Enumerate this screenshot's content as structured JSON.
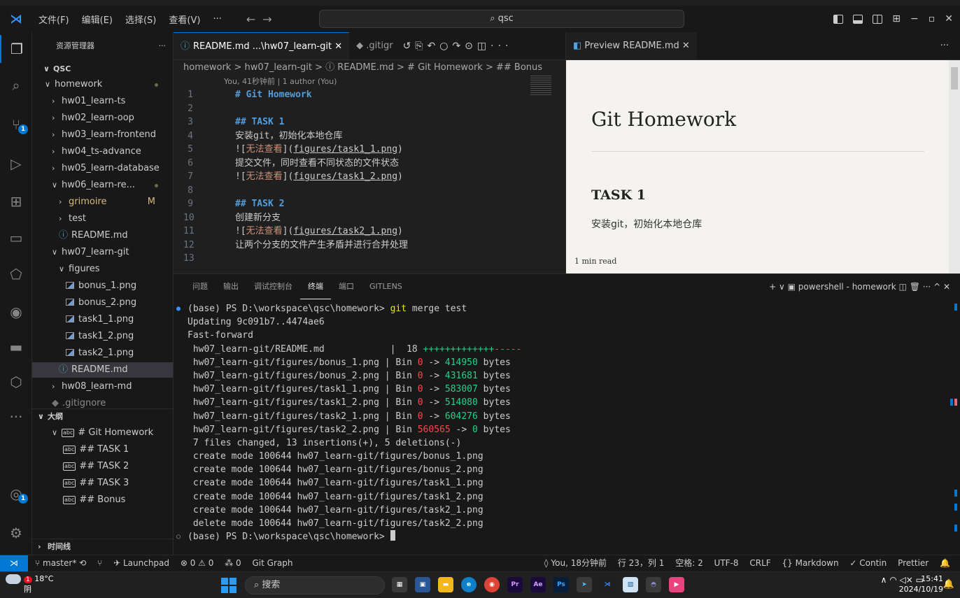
{
  "titlebar": {
    "menus": [
      "文件(F)",
      "编辑(E)",
      "选择(S)",
      "查看(V)",
      "···"
    ],
    "search": "qsc"
  },
  "sidebar": {
    "title": "资源管理器",
    "root": "QSC",
    "tree": [
      {
        "label": "homework",
        "depth": 1,
        "kind": "folder-open",
        "color": "#cccccc"
      },
      {
        "label": "hw01_learn-ts",
        "depth": 2,
        "kind": "folder"
      },
      {
        "label": "hw02_learn-oop",
        "depth": 2,
        "kind": "folder"
      },
      {
        "label": "hw03_learn-frontend",
        "depth": 2,
        "kind": "folder"
      },
      {
        "label": "hw04_ts-advance",
        "depth": 2,
        "kind": "folder"
      },
      {
        "label": "hw05_learn-database",
        "depth": 2,
        "kind": "folder"
      },
      {
        "label": "hw06_learn-re...",
        "depth": 2,
        "kind": "folder-open"
      },
      {
        "label": "grimoire",
        "depth": 3,
        "kind": "folder",
        "status": "M"
      },
      {
        "label": "test",
        "depth": 3,
        "kind": "folder"
      },
      {
        "label": "README.md",
        "depth": 3,
        "kind": "info"
      },
      {
        "label": "hw07_learn-git",
        "depth": 2,
        "kind": "folder-open"
      },
      {
        "label": "figures",
        "depth": 3,
        "kind": "folder-open"
      },
      {
        "label": "bonus_1.png",
        "depth": 4,
        "kind": "image"
      },
      {
        "label": "bonus_2.png",
        "depth": 4,
        "kind": "image"
      },
      {
        "label": "task1_1.png",
        "depth": 4,
        "kind": "image"
      },
      {
        "label": "task1_2.png",
        "depth": 4,
        "kind": "image"
      },
      {
        "label": "task2_1.png",
        "depth": 4,
        "kind": "image"
      },
      {
        "label": "README.md",
        "depth": 3,
        "kind": "info",
        "selected": true
      },
      {
        "label": "hw08_learn-md",
        "depth": 2,
        "kind": "folder"
      },
      {
        "label": ".gitignore",
        "depth": 2,
        "kind": "file"
      }
    ],
    "outline_title": "大纲",
    "outline": [
      {
        "label": "# Git Homework",
        "depth": 1
      },
      {
        "label": "## TASK 1",
        "depth": 2
      },
      {
        "label": "## TASK 2",
        "depth": 2
      },
      {
        "label": "## TASK 3",
        "depth": 2
      },
      {
        "label": "## Bonus",
        "depth": 2
      }
    ],
    "timeline_title": "时间线"
  },
  "editor": {
    "tabs": [
      "README.md ...\\hw07_learn-git",
      ".gitigr"
    ],
    "breadcrumb": "homework > hw07_learn-git > ⓘ README.md > # Git Homework > ## Bonus",
    "codelens": "You, 41秒钟前 | 1 author (You)",
    "lines": [
      {
        "n": "1",
        "parts": [
          [
            "h",
            "# Git Homework"
          ]
        ]
      },
      {
        "n": "2",
        "parts": []
      },
      {
        "n": "3",
        "parts": [
          [
            "h",
            "## TASK 1"
          ]
        ]
      },
      {
        "n": "4",
        "parts": [
          [
            "t",
            "安装git，初始化本地仓库"
          ]
        ]
      },
      {
        "n": "5",
        "parts": [
          [
            "t",
            "!["
          ],
          [
            "r",
            "无法查看"
          ],
          [
            "t",
            "]("
          ],
          [
            "l",
            "figures/task1_1.png"
          ],
          [
            "t",
            ")"
          ]
        ]
      },
      {
        "n": "6",
        "parts": [
          [
            "t",
            "提交文件，同时查看不同状态的文件状态"
          ]
        ]
      },
      {
        "n": "7",
        "parts": [
          [
            "t",
            "!["
          ],
          [
            "r",
            "无法查看"
          ],
          [
            "t",
            "]("
          ],
          [
            "l",
            "figures/task1_2.png"
          ],
          [
            "t",
            ")"
          ]
        ]
      },
      {
        "n": "8",
        "parts": []
      },
      {
        "n": "9",
        "parts": [
          [
            "h",
            "## TASK 2"
          ]
        ]
      },
      {
        "n": "10",
        "parts": [
          [
            "t",
            "创建新分支"
          ]
        ]
      },
      {
        "n": "11",
        "parts": [
          [
            "t",
            "!["
          ],
          [
            "r",
            "无法查看"
          ],
          [
            "t",
            "]("
          ],
          [
            "l",
            "figures/task2_1.png"
          ],
          [
            "t",
            ")"
          ]
        ]
      },
      {
        "n": "12",
        "parts": [
          [
            "t",
            "让两个分支的文件产生矛盾并进行合并处理"
          ]
        ]
      },
      {
        "n": "13",
        "parts": []
      }
    ]
  },
  "preview": {
    "tab": "Preview README.md",
    "h1": "Git Homework",
    "h2": "TASK 1",
    "partial": "安装git，初始化本地仓库",
    "readtime": "1 min read"
  },
  "panel": {
    "tabs": [
      "问题",
      "输出",
      "调试控制台",
      "终端",
      "端口",
      "GITLENS"
    ],
    "active_tab": "终端",
    "terminal_name": "powershell - homework",
    "terminal": [
      {
        "mark": "dot",
        "parts": [
          [
            "w",
            "(base) PS D:\\workspace\\qsc\\homework> "
          ],
          [
            "y",
            "git"
          ],
          [
            "w",
            " merge test"
          ]
        ]
      },
      {
        "parts": [
          [
            "w",
            "Updating 9c091b7..4474ae6"
          ]
        ]
      },
      {
        "parts": [
          [
            "w",
            "Fast-forward"
          ]
        ]
      },
      {
        "parts": [
          [
            "w",
            " hw07_learn-git/README.md            |  18 "
          ],
          [
            "g",
            "+++++++++++++"
          ],
          [
            "r",
            "-----"
          ]
        ]
      },
      {
        "parts": [
          [
            "w",
            " hw07_learn-git/figures/bonus_1.png | Bin "
          ],
          [
            "r",
            "0"
          ],
          [
            "w",
            " -> "
          ],
          [
            "g",
            "414950"
          ],
          [
            "w",
            " bytes"
          ]
        ]
      },
      {
        "parts": [
          [
            "w",
            " hw07_learn-git/figures/bonus_2.png | Bin "
          ],
          [
            "r",
            "0"
          ],
          [
            "w",
            " -> "
          ],
          [
            "g",
            "431681"
          ],
          [
            "w",
            " bytes"
          ]
        ]
      },
      {
        "parts": [
          [
            "w",
            " hw07_learn-git/figures/task1_1.png | Bin "
          ],
          [
            "r",
            "0"
          ],
          [
            "w",
            " -> "
          ],
          [
            "g",
            "583007"
          ],
          [
            "w",
            " bytes"
          ]
        ]
      },
      {
        "parts": [
          [
            "w",
            " hw07_learn-git/figures/task1_2.png | Bin "
          ],
          [
            "r",
            "0"
          ],
          [
            "w",
            " -> "
          ],
          [
            "g",
            "514080"
          ],
          [
            "w",
            " bytes"
          ]
        ]
      },
      {
        "parts": [
          [
            "w",
            " hw07_learn-git/figures/task2_1.png | Bin "
          ],
          [
            "r",
            "0"
          ],
          [
            "w",
            " -> "
          ],
          [
            "g",
            "604276"
          ],
          [
            "w",
            " bytes"
          ]
        ]
      },
      {
        "parts": [
          [
            "w",
            " hw07_learn-git/figures/task2_2.png | Bin "
          ],
          [
            "r",
            "560565"
          ],
          [
            "w",
            " -> "
          ],
          [
            "g",
            "0"
          ],
          [
            "w",
            " bytes"
          ]
        ]
      },
      {
        "parts": [
          [
            "w",
            " 7 files changed, 13 insertions(+), 5 deletions(-)"
          ]
        ]
      },
      {
        "parts": [
          [
            "w",
            " create mode 100644 hw07_learn-git/figures/bonus_1.png"
          ]
        ]
      },
      {
        "parts": [
          [
            "w",
            " create mode 100644 hw07_learn-git/figures/bonus_2.png"
          ]
        ]
      },
      {
        "parts": [
          [
            "w",
            " create mode 100644 hw07_learn-git/figures/task1_1.png"
          ]
        ]
      },
      {
        "parts": [
          [
            "w",
            " create mode 100644 hw07_learn-git/figures/task1_2.png"
          ]
        ]
      },
      {
        "parts": [
          [
            "w",
            " create mode 100644 hw07_learn-git/figures/task2_1.png"
          ]
        ]
      },
      {
        "parts": [
          [
            "w",
            " delete mode 100644 hw07_learn-git/figures/task2_2.png"
          ]
        ]
      },
      {
        "mark": "circle",
        "parts": [
          [
            "w",
            "(base) PS D:\\workspace\\qsc\\homework> "
          ]
        ],
        "cursor": true
      }
    ]
  },
  "statusbar": {
    "branch": "master*",
    "launchpad": "Launchpad",
    "problems": "⊗ 0 ⚠ 0",
    "ports": "0",
    "gitgraph": "Git Graph",
    "blame": "You, 18分钟前",
    "position": "行 23，列 1",
    "spaces": "空格: 2",
    "encoding": "UTF-8",
    "eol": "CRLF",
    "language": "Markdown",
    "continue": "Contin",
    "prettier": "Prettier"
  },
  "taskbar": {
    "temp": "18°C",
    "weather": "阴",
    "weather_badge": "1",
    "search": "搜索",
    "time": "15:41",
    "date": "2024/10/19",
    "ime": "拼"
  },
  "colors": {
    "accent": "#0078d4",
    "git_add": "#23d18b",
    "git_del": "#f14c4c"
  }
}
